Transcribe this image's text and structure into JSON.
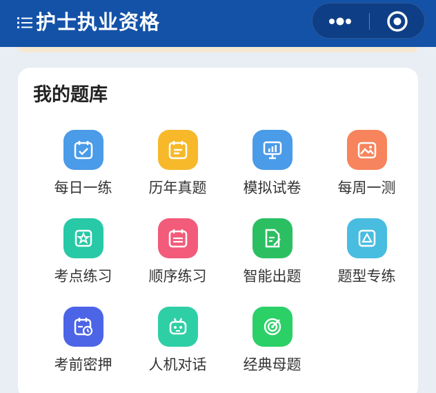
{
  "header": {
    "title": "护士执业资格",
    "menu_icon": "list-menu-icon",
    "more_icon": "more-dots-icon",
    "close_icon": "target-close-icon"
  },
  "bank": {
    "heading": "我的题库",
    "items": [
      {
        "label": "每日一练",
        "color": "#4a9be8",
        "icon": "calendar-check-icon"
      },
      {
        "label": "历年真题",
        "color": "#f7b92a",
        "icon": "calendar-list-icon"
      },
      {
        "label": "模拟试卷",
        "color": "#4a9be8",
        "icon": "presentation-chart-icon"
      },
      {
        "label": "每周一测",
        "color": "#f7845c",
        "icon": "picture-icon"
      },
      {
        "label": "考点练习",
        "color": "#27c9a6",
        "icon": "star-badge-icon"
      },
      {
        "label": "顺序练习",
        "color": "#f25b7a",
        "icon": "calendar-order-icon"
      },
      {
        "label": "智能出题",
        "color": "#2bbf62",
        "icon": "document-edit-icon"
      },
      {
        "label": "题型专练",
        "color": "#48bde0",
        "icon": "triangle-frame-icon"
      },
      {
        "label": "考前密押",
        "color": "#4c64e6",
        "icon": "calendar-clock-icon"
      },
      {
        "label": "人机对话",
        "color": "#2fcfa5",
        "icon": "robot-icon"
      },
      {
        "label": "经典母题",
        "color": "#2bd067",
        "icon": "target-icon"
      }
    ]
  }
}
